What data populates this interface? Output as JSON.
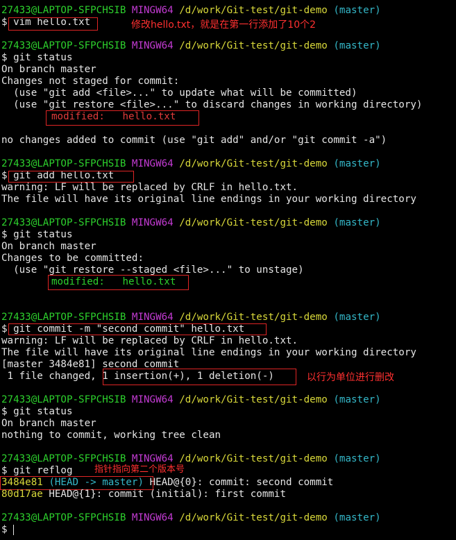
{
  "colors": {
    "background": "#000000",
    "user_host": "#2dd12d",
    "shell": "#c33bd3",
    "path": "#d8d83a",
    "branch": "#34b7c8",
    "text": "#e6e6e6",
    "modified_unstaged": "#e23b3b",
    "modified_staged": "#2dd12d",
    "annotation": "#ff3030"
  },
  "prompt": {
    "user_host": "27433@LAPTOP-SFPCHSIB",
    "shell": "MINGW64",
    "path": "/d/work/Git-test/git-demo",
    "branch": "(master)",
    "symbol": "$"
  },
  "blocks": [
    {
      "command": "vim hello.txt",
      "annotation": "修改hello.txt，就是在第一行添加了10个2"
    },
    {
      "command": "git status",
      "output": [
        "On branch master",
        "Changes not staged for commit:",
        "  (use \"git add <file>...\" to update what will be committed)",
        "  (use \"git restore <file>...\" to discard changes in working directory)"
      ],
      "modified": "modified:   hello.txt",
      "after": "no changes added to commit (use \"git add\" and/or \"git commit -a\")"
    },
    {
      "command": "git add hello.txt",
      "output": [
        "warning: LF will be replaced by CRLF in hello.txt.",
        "The file will have its original line endings in your working directory"
      ]
    },
    {
      "command": "git status",
      "output": [
        "On branch master",
        "Changes to be committed:",
        "  (use \"git restore --staged <file>...\" to unstage)"
      ],
      "modified": "modified:   hello.txt"
    },
    {
      "command": "git commit -m \"second commit\" hello.txt",
      "output": [
        "warning: LF will be replaced by CRLF in hello.txt.",
        "The file will have its original line endings in your working directory",
        "[master 3484e81] second commit"
      ],
      "changed_prefix": " 1 file changed,",
      "changed_detail": "1 insertion(+), 1 deletion(-)",
      "annotation": "以行为单位进行删改"
    },
    {
      "command": "git status",
      "output": [
        "On branch master",
        "nothing to commit, working tree clean"
      ]
    },
    {
      "command": "git reflog",
      "annotation": "指针指向第二个版本号",
      "reflog": [
        {
          "hash": "3484e81",
          "refs": "(HEAD -> master)",
          "text": "HEAD@{0}: commit: second commit"
        },
        {
          "hash": "80d17ae",
          "refs": "",
          "text": "HEAD@{1}: commit (initial): first commit"
        }
      ]
    }
  ]
}
